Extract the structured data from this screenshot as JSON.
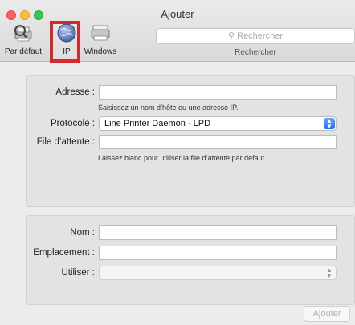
{
  "window": {
    "title": "Ajouter"
  },
  "toolbar": {
    "items": [
      {
        "label": "Par défaut",
        "icon": "default-printer-icon"
      },
      {
        "label": "IP",
        "icon": "globe-icon"
      },
      {
        "label": "Windows",
        "icon": "windows-printer-icon"
      }
    ],
    "search": {
      "placeholder": "Rechercher",
      "caption": "Rechercher"
    }
  },
  "form": {
    "address": {
      "label": "Adresse :",
      "value": "",
      "hint": "Saisissez un nom d’hôte ou une adresse IP."
    },
    "protocol": {
      "label": "Protocole :",
      "value": "Line Printer Daemon - LPD"
    },
    "queue": {
      "label": "File d’attente :",
      "value": "",
      "hint": "Laissez blanc pour utiliser la file d’attente par défaut."
    },
    "name": {
      "label": "Nom :",
      "value": ""
    },
    "location": {
      "label": "Emplacement :",
      "value": ""
    },
    "use": {
      "label": "Utiliser :",
      "value": ""
    }
  },
  "actions": {
    "add_label": "Ajouter"
  },
  "colors": {
    "highlight": "#d8292a",
    "accent": "#1d6ff2"
  }
}
